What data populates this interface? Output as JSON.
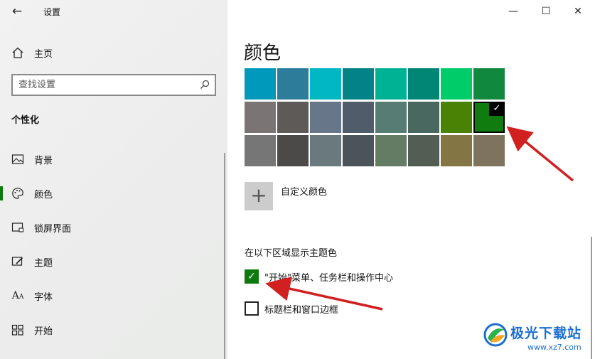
{
  "window": {
    "title": "设置",
    "back_icon": "back-arrow-icon",
    "controls": {
      "minimize": "—",
      "maximize": "☐",
      "close": "✕"
    }
  },
  "sidebar": {
    "home_label": "主页",
    "search_placeholder": "查找设置",
    "section_title": "个性化",
    "items": [
      {
        "label": "背景",
        "icon": "picture-icon",
        "glyph": "▭"
      },
      {
        "label": "颜色",
        "icon": "palette-icon",
        "glyph": "◍",
        "active": true
      },
      {
        "label": "锁屏界面",
        "icon": "lock-screen-icon",
        "glyph": "▭"
      },
      {
        "label": "主题",
        "icon": "theme-brush-icon",
        "glyph": "✎"
      },
      {
        "label": "字体",
        "icon": "font-icon",
        "glyph": "A"
      },
      {
        "label": "开始",
        "icon": "start-grid-icon",
        "glyph": "⊞"
      }
    ]
  },
  "main": {
    "page_title": "颜色",
    "swatches": [
      [
        "#0099bc",
        "#2d7d9a",
        "#00b7c3",
        "#038387",
        "#00b294",
        "#018574",
        "#00cc6a",
        "#10893e"
      ],
      [
        "#7a7574",
        "#5d5a58",
        "#68768a",
        "#515c6b",
        "#567c73",
        "#486860",
        "#498205",
        "#107c10"
      ],
      [
        "#767676",
        "#4c4a48",
        "#69797e",
        "#4a5459",
        "#647c64",
        "#525e54",
        "#847545",
        "#7e735f"
      ]
    ],
    "selected_swatch": {
      "row": 1,
      "col": 7
    },
    "selected_check": "✓",
    "custom_color_glyph": "+",
    "custom_color_label": "自定义颜色",
    "accent_section_title": "在以下区域显示主题色",
    "options": [
      {
        "label": "\"开始\"菜单、任务栏和操作中心",
        "checked": true
      },
      {
        "label": "标题栏和窗口边框",
        "checked": false
      }
    ],
    "check_glyph": "✓"
  },
  "colors": {
    "accent": "#0e7a0d",
    "annotation_arrow": "#d0201f",
    "watermark": "#1c6fd1"
  },
  "watermark": {
    "name": "极光下载站",
    "url": "www.xz7.com"
  }
}
